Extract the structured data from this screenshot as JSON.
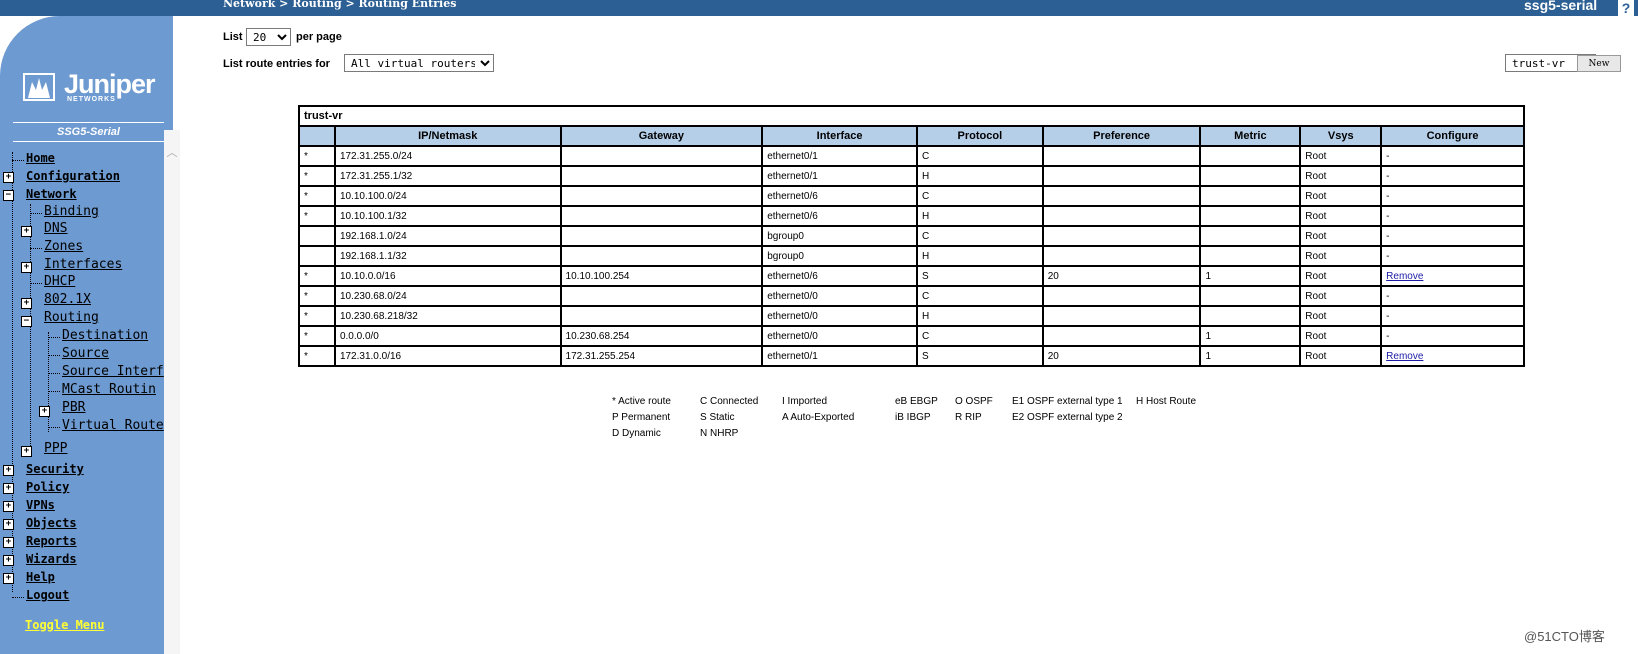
{
  "header": {
    "breadcrumb": "Network > Routing > Routing Entries",
    "device_name": "ssg5-serial",
    "help_label": "?"
  },
  "sidebar": {
    "logo_text": "Juniper",
    "logo_sub": "NETWORKS",
    "model": "SSG5-Serial",
    "items": [
      {
        "label": "Home"
      },
      {
        "label": "Configuration"
      },
      {
        "label": "Network"
      },
      {
        "label": "Binding"
      },
      {
        "label": "DNS"
      },
      {
        "label": "Zones"
      },
      {
        "label": "Interfaces"
      },
      {
        "label": "DHCP"
      },
      {
        "label": "802.1X"
      },
      {
        "label": "Routing"
      },
      {
        "label": "Destination"
      },
      {
        "label": "Source"
      },
      {
        "label": "Source Interf"
      },
      {
        "label": "MCast Routin"
      },
      {
        "label": "PBR"
      },
      {
        "label": "Virtual Route"
      },
      {
        "label": "PPP"
      },
      {
        "label": "Security"
      },
      {
        "label": "Policy"
      },
      {
        "label": "VPNs"
      },
      {
        "label": "Objects"
      },
      {
        "label": "Reports"
      },
      {
        "label": "Wizards"
      },
      {
        "label": "Help"
      },
      {
        "label": "Logout"
      }
    ],
    "toggle_menu": "Toggle Menu"
  },
  "controls": {
    "list_label": "List",
    "list_value": "20",
    "per_page_label": "per page",
    "route_entries_label": "List route entries for",
    "virtual_router_value": "All virtual routers",
    "vr_select_value": "trust-vr",
    "new_label": "New"
  },
  "table": {
    "title": "trust-vr",
    "columns": [
      "",
      "IP/Netmask",
      "Gateway",
      "Interface",
      "Protocol",
      "Preference",
      "Metric",
      "Vsys",
      "Configure"
    ],
    "rows": [
      [
        "*",
        "172.31.255.0/24",
        "",
        "ethernet0/1",
        "C",
        "",
        "",
        "Root",
        "-"
      ],
      [
        "*",
        "172.31.255.1/32",
        "",
        "ethernet0/1",
        "H",
        "",
        "",
        "Root",
        "-"
      ],
      [
        "*",
        "10.10.100.0/24",
        "",
        "ethernet0/6",
        "C",
        "",
        "",
        "Root",
        "-"
      ],
      [
        "*",
        "10.10.100.1/32",
        "",
        "ethernet0/6",
        "H",
        "",
        "",
        "Root",
        "-"
      ],
      [
        "",
        "192.168.1.0/24",
        "",
        "bgroup0",
        "C",
        "",
        "",
        "Root",
        "-"
      ],
      [
        "",
        "192.168.1.1/32",
        "",
        "bgroup0",
        "H",
        "",
        "",
        "Root",
        "-"
      ],
      [
        "*",
        "10.10.0.0/16",
        "10.10.100.254",
        "ethernet0/6",
        "S",
        "20",
        "1",
        "Root",
        "Remove"
      ],
      [
        "*",
        "10.230.68.0/24",
        "",
        "ethernet0/0",
        "C",
        "",
        "",
        "Root",
        "-"
      ],
      [
        "*",
        "10.230.68.218/32",
        "",
        "ethernet0/0",
        "H",
        "",
        "",
        "Root",
        "-"
      ],
      [
        "*",
        "0.0.0.0/0",
        "10.230.68.254",
        "ethernet0/0",
        "C",
        "",
        "1",
        "Root",
        "-"
      ],
      [
        "*",
        "172.31.0.0/16",
        "172.31.255.254",
        "ethernet0/1",
        "S",
        "20",
        "1",
        "Root",
        "Remove"
      ]
    ]
  },
  "legend": {
    "active": "* Active route",
    "connected": "C Connected",
    "imported": "I Imported",
    "ebgp": "eB EBGP",
    "ospf": "O OSPF",
    "e1": "E1 OSPF external type 1",
    "host": "H Host Route",
    "permanent": "P Permanent",
    "static": "S Static",
    "auto": "A Auto-Exported",
    "ibgp": "iB IBGP",
    "rip": "R RIP",
    "e2": "E2 OSPF external type 2",
    "dynamic": "D Dynamic",
    "nhrp": "N NHRP"
  },
  "watermark": "@51CTO博客",
  "colors": {
    "topbar": "#2c5f93",
    "sidebar": "#6d9ad0",
    "table_header": "#b5cfe9",
    "toggle_menu": "#ffff33"
  }
}
